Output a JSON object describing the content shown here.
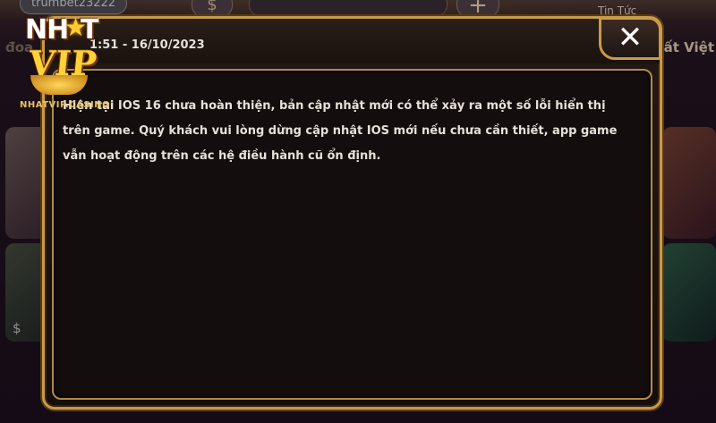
{
  "background": {
    "username": "trumbet23222",
    "dollar_symbol": "$",
    "plus_symbol": "+",
    "news_label": "Tin Tức",
    "left_label": "đoa",
    "right_label": "hất Việt",
    "small_dollar": "$"
  },
  "logo": {
    "title": "NH",
    "title_end": "T",
    "star": "★",
    "vip": "VIP",
    "caption": "NHATVIP.CASINO"
  },
  "modal": {
    "close_label": "✕",
    "timestamp": "1:51 - 16/10/2023",
    "message": "Hiện tại IOS 16 chưa hoàn thiện, bản cập nhật mới có thể xảy ra một số lỗi hiển thị trên game. Quý khách vui lòng dừng cập nhật IOS mới nếu chưa cần thiết, app game vẫn hoạt động trên các hệ điều hành cũ ổn định."
  }
}
